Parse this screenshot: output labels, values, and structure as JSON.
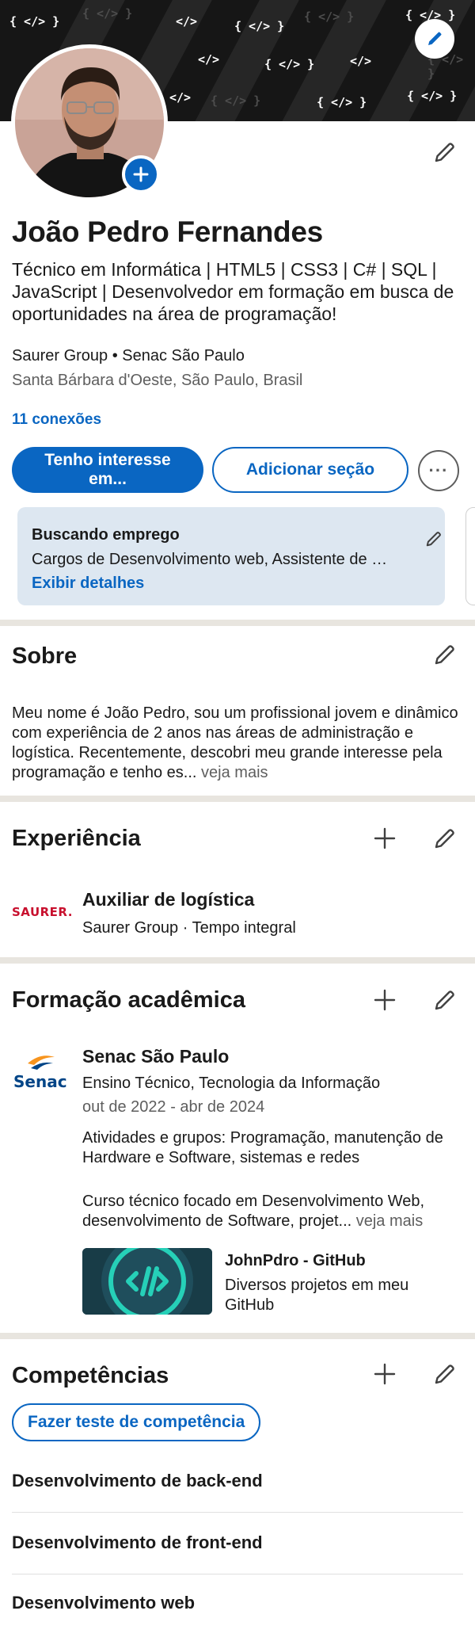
{
  "banner": {
    "code_snippets": [
      "{ </> }",
      "{ </> }",
      "</>",
      "{ </> }",
      "{ </> }",
      "{ </> }",
      "{ </> }",
      "{ </> }",
      "{ </> }",
      "</>",
      "</>",
      "</>",
      "{ </> }",
      "{ </> }"
    ],
    "edit_icon": "pencil-icon"
  },
  "profile": {
    "name": "João Pedro Fernandes",
    "headline": "Técnico em Informática | HTML5 | CSS3 | C# | SQL | JavaScript | Desenvolvedor em formação em busca de oportunidades na área de programação!",
    "company_line": "Saurer Group • Senac São Paulo",
    "location": "Santa Bárbara d'Oeste, São Paulo, Brasil",
    "connections": "11 conexões"
  },
  "actions": {
    "primary": "Tenho interesse em...",
    "secondary": "Adicionar seção",
    "more": "···"
  },
  "open_to_work": {
    "title": "Buscando emprego",
    "description": "Cargos de Desenvolvimento web, Assistente de suporte",
    "link": "Exibir detalhes"
  },
  "about": {
    "title": "Sobre",
    "text": "Meu nome é João Pedro, sou um profissional jovem e dinâmico com experiência de 2 anos nas áreas de administração e logística. Recentemente, descobri meu grande interesse pela programação e tenho es...",
    "see_more": " veja mais"
  },
  "experience": {
    "title": "Experiência",
    "items": [
      {
        "logo": "SAURER.",
        "role": "Auxiliar de logística",
        "company": "Saurer Group · Tempo integral"
      }
    ]
  },
  "education": {
    "title": "Formação acadêmica",
    "items": [
      {
        "logo": "Senac",
        "school": "Senac São Paulo",
        "degree": "Ensino Técnico, Tecnologia da Informação",
        "dates": "out de 2022 - abr de 2024",
        "activities": "Atividades e grupos: Programação, manutenção de Hardware e Software, sistemas e redes",
        "description": "Curso técnico focado em Desenvolvimento Web, desenvolvimento de Software, projet...",
        "see_more": " veja mais",
        "media": {
          "title": "JohnPdro - GitHub",
          "description": "Diversos projetos em meu GitHub"
        }
      }
    ]
  },
  "skills": {
    "title": "Competências",
    "test_button": "Fazer teste de competência",
    "items": [
      "Desenvolvimento de back-end",
      "Desenvolvimento de front-end",
      "Desenvolvimento web"
    ]
  },
  "colors": {
    "accent": "#0a66c2",
    "card_bg": "#dde7f1",
    "divider": "#e8e5df",
    "saurer_red": "#c8102e",
    "senac_blue": "#004587",
    "senac_orange": "#f7941d"
  }
}
